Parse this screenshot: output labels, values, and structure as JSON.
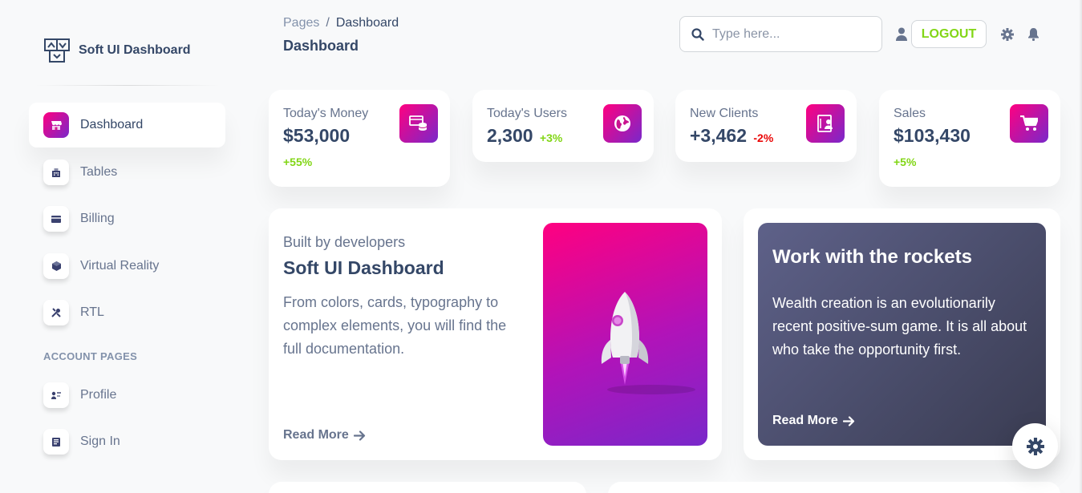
{
  "sidebar": {
    "brand": "Soft UI Dashboard",
    "items": [
      {
        "label": "Dashboard",
        "icon": "shop-icon",
        "active": true
      },
      {
        "label": "Tables",
        "icon": "office-icon"
      },
      {
        "label": "Billing",
        "icon": "credit-card-icon"
      },
      {
        "label": "Virtual Reality",
        "icon": "box-3d-icon"
      },
      {
        "label": "RTL",
        "icon": "settings-tools-icon"
      }
    ],
    "section_title": "ACCOUNT PAGES",
    "account_items": [
      {
        "label": "Profile",
        "icon": "customer-support-icon"
      },
      {
        "label": "Sign In",
        "icon": "document-icon"
      }
    ]
  },
  "header": {
    "breadcrumb_root": "Pages",
    "breadcrumb_separator": "/",
    "breadcrumb_current": "Dashboard",
    "page_title": "Dashboard",
    "search_placeholder": "Type here...",
    "logout_label": "LOGOUT"
  },
  "stats": [
    {
      "title": "Today's Money",
      "value": "$53,000",
      "change": "+55%",
      "trend": "up",
      "icon": "money-coins-icon"
    },
    {
      "title": "Today's Users",
      "value": "2,300",
      "change": "+3%",
      "trend": "up",
      "icon": "world-icon"
    },
    {
      "title": "New Clients",
      "value": "+3,462",
      "change": "-2%",
      "trend": "down",
      "icon": "paper-diploma-icon"
    },
    {
      "title": "Sales",
      "value": "$103,430",
      "change": "+5%",
      "trend": "up",
      "icon": "cart-icon"
    }
  ],
  "feature": {
    "kicker": "Built by developers",
    "title": "Soft UI Dashboard",
    "description": "From colors, cards, typography to complex elements, you will find the full documentation.",
    "link": "Read More",
    "illustration": "rocket-icon"
  },
  "rockets": {
    "title": "Work with the rockets",
    "text": "Wealth creation is an evolutionarily recent positive-sum game. It is all about who take the opportunity first.",
    "link": "Read More"
  },
  "colors": {
    "primary_gradient_start": "#7928ca",
    "primary_gradient_end": "#ff0080",
    "success": "#82d616",
    "danger": "#ea0606",
    "text_dark": "#344767",
    "text_muted": "#67748e"
  }
}
